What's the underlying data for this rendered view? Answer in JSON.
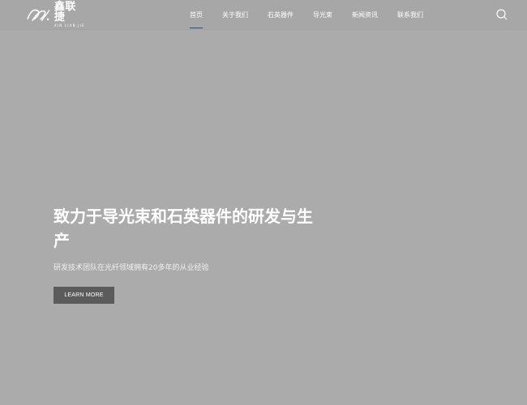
{
  "brand": {
    "name_cn": "鑫联捷",
    "name_en": "XIN LIAN JIE",
    "logo_icon": "brand-swoosh-icon"
  },
  "nav": {
    "items": [
      {
        "label": "首页",
        "active": true
      },
      {
        "label": "关于我们",
        "active": false
      },
      {
        "label": "石英器件",
        "active": false
      },
      {
        "label": "导光束",
        "active": false
      },
      {
        "label": "新闻资讯",
        "active": false
      },
      {
        "label": "联系我们",
        "active": false
      }
    ],
    "search_icon": "search-icon"
  },
  "hero": {
    "title": "致力于导光束和石英器件的研发与生产",
    "subtitle": "研发技术团队在光纤领域拥有20多年的从业经验",
    "cta_label": "LEARN MORE"
  },
  "colors": {
    "background": "#ababab",
    "header": "#a7a7a7",
    "active_underline": "#1d4f8c",
    "button": "#5b5b5b",
    "text": "#ffffff"
  }
}
